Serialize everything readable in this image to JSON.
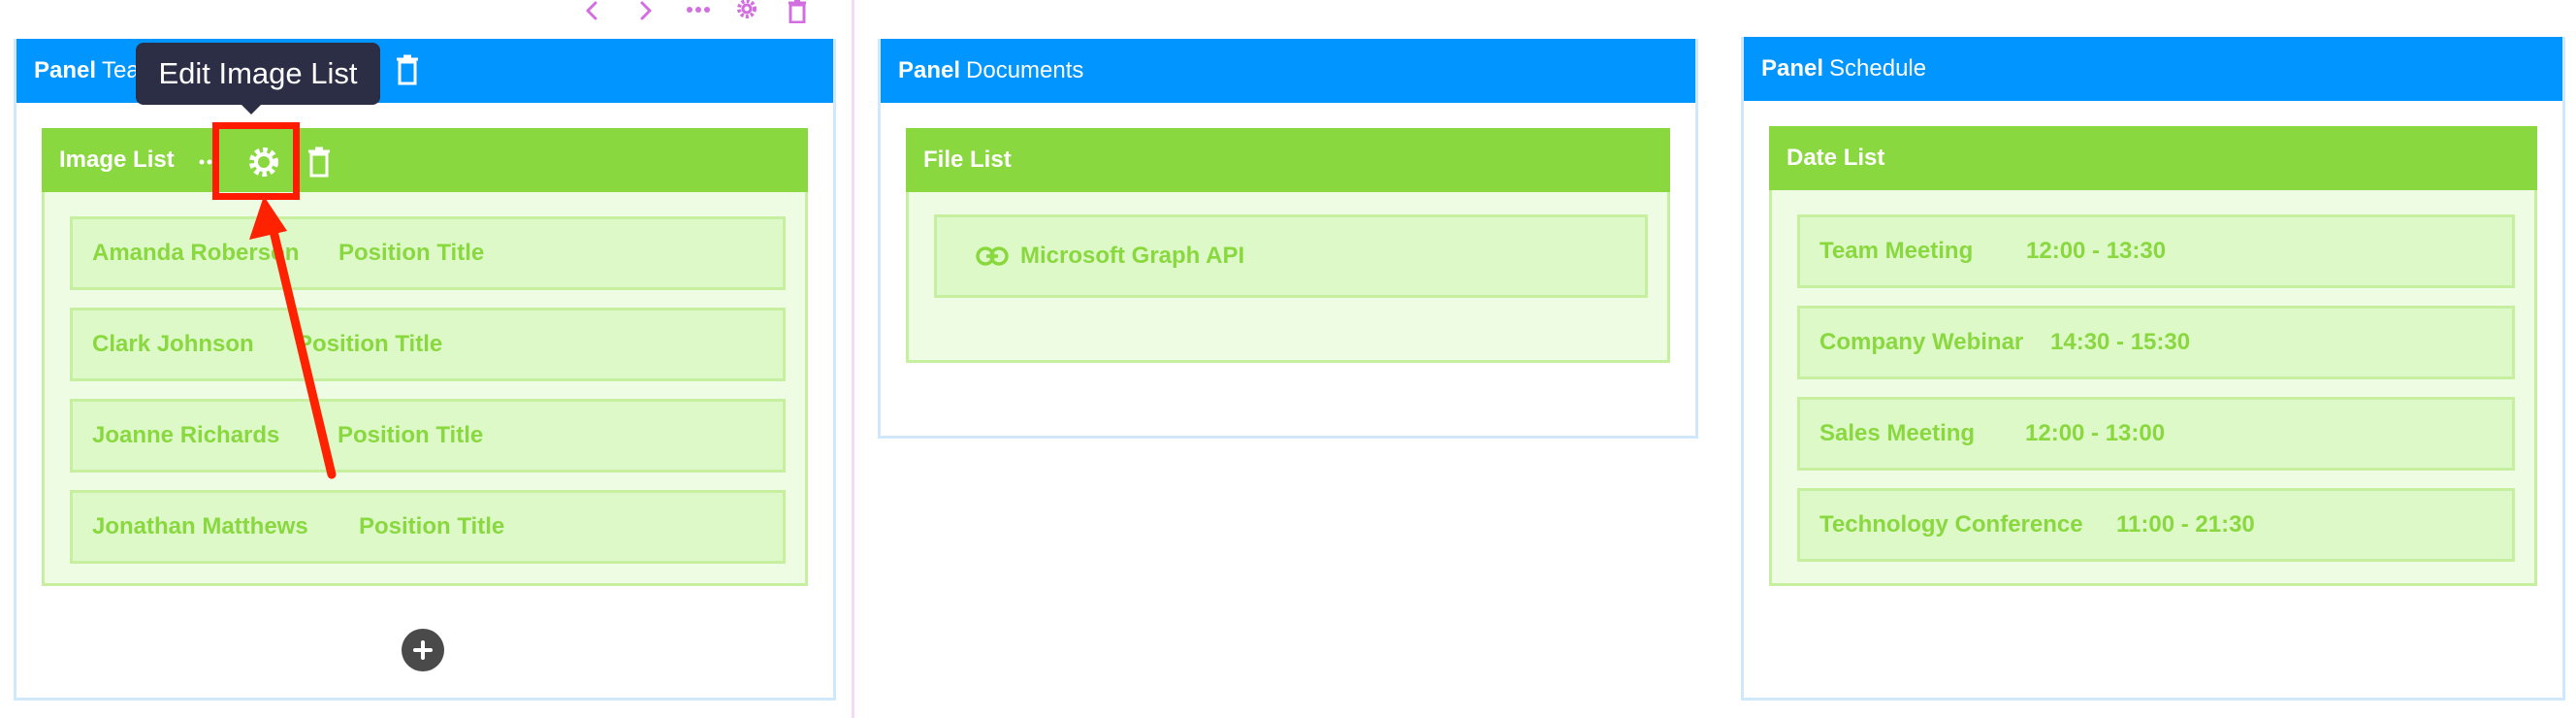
{
  "section_toolbar": {
    "icons": [
      "chevron-left-icon",
      "chevron-right-icon",
      "more-icon",
      "gear-icon",
      "trash-icon"
    ],
    "color": "#d36ee0"
  },
  "colors": {
    "panel_header": "#0095ff",
    "widget_header": "#8ad83f",
    "item_text": "#8ad83f",
    "tooltip_bg": "#2b2e45",
    "highlight": "#ff1a00",
    "arrow": "#ff2200"
  },
  "tooltip": {
    "text": "Edit Image List"
  },
  "panels": [
    {
      "prefix": "Panel",
      "title": "Tea",
      "widget": {
        "title": "Image List",
        "items": [
          {
            "name": "Amanda Roberson",
            "detail": "Position Title"
          },
          {
            "name": "Clark Johnson",
            "detail": "Position Title"
          },
          {
            "name": "Joanne Richards",
            "detail": "Position Title"
          },
          {
            "name": "Jonathan Matthews",
            "detail": "Position Title"
          }
        ]
      }
    },
    {
      "prefix": "Panel",
      "title": "Documents",
      "widget": {
        "title": "File List",
        "items": [
          {
            "name": "Microsoft Graph API",
            "icon": "link-icon"
          }
        ]
      }
    },
    {
      "prefix": "Panel",
      "title": "Schedule",
      "widget": {
        "title": "Date List",
        "items": [
          {
            "name": "Team Meeting",
            "detail": "12:00 - 13:30"
          },
          {
            "name": "Company Webinar",
            "detail": "14:30 - 15:30"
          },
          {
            "name": "Sales Meeting",
            "detail": "12:00 - 13:00"
          },
          {
            "name": "Technology Conference",
            "detail": "11:00 - 21:30"
          }
        ]
      }
    }
  ]
}
